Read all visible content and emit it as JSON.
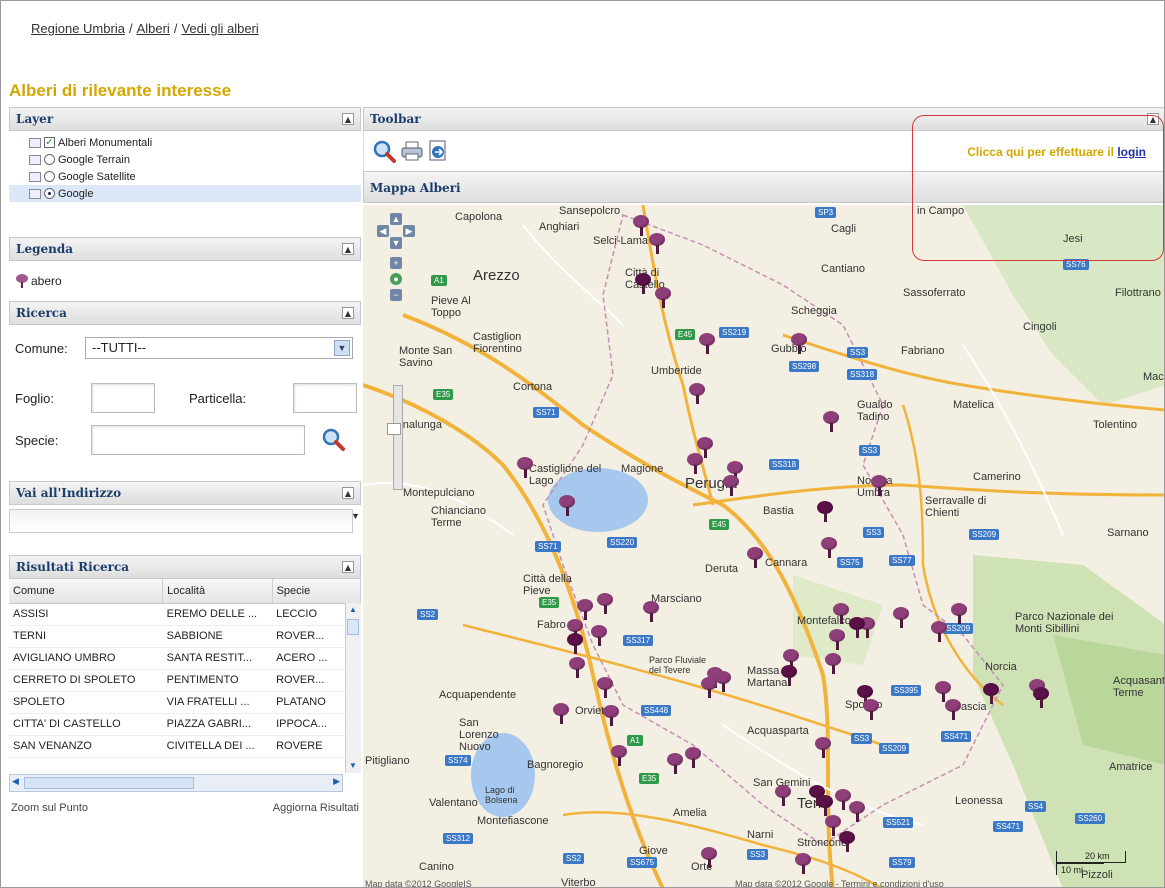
{
  "breadcrumb": {
    "items": [
      "Regione Umbria",
      "Alberi",
      "Vedi gli alberi"
    ],
    "separator": "/"
  },
  "page_title": "Alberi di rilevante interesse",
  "layer_panel": {
    "title": "Layer",
    "items": [
      {
        "label": "Alberi Monumentali",
        "control": "checkbox",
        "checked": true
      },
      {
        "label": "Google Terrain",
        "control": "radio",
        "checked": false
      },
      {
        "label": "Google Satellite",
        "control": "radio",
        "checked": false
      },
      {
        "label": "Google",
        "control": "radio",
        "checked": true
      }
    ]
  },
  "legend_panel": {
    "title": "Legenda",
    "items": [
      {
        "label": "abero",
        "icon": "tree-icon"
      }
    ]
  },
  "search_panel": {
    "title": "Ricerca",
    "comune_label": "Comune:",
    "comune_value": "--TUTTI--",
    "foglio_label": "Foglio:",
    "particella_label": "Particella:",
    "specie_label": "Specie:",
    "search_icon": "magnifier-icon"
  },
  "address_panel": {
    "title": "Vai all'Indirizzo",
    "value": ""
  },
  "results_panel": {
    "title": "Risultati Ricerca",
    "columns": [
      "Comune",
      "Località",
      "Specie"
    ],
    "rows": [
      [
        "ASSISI",
        "EREMO DELLE ...",
        "LECCIO"
      ],
      [
        "TERNI",
        "SABBIONE",
        "ROVER..."
      ],
      [
        "AVIGLIANO UMBRO",
        "SANTA RESTIT...",
        "ACERO ..."
      ],
      [
        "CERRETO DI SPOLETO",
        "PENTIMENTO",
        "ROVER..."
      ],
      [
        "SPOLETO",
        "VIA FRATELLI ...",
        "PLATANO"
      ],
      [
        "CITTA' DI CASTELLO",
        "PIAZZA GABRI...",
        "IPPOCA..."
      ],
      [
        "SAN VENANZO",
        "CIVITELLA DEI ...",
        "ROVERE"
      ]
    ],
    "zoom_label": "Zoom sul Punto",
    "refresh_label": "Aggiorna Risultati"
  },
  "toolbar": {
    "title": "Toolbar",
    "icons": [
      "zoom-icon",
      "print-icon",
      "export-icon"
    ],
    "login_prompt": "Clicca qui per effettuare il",
    "login_link": "login"
  },
  "map": {
    "title": "Mappa Alberi",
    "places": [
      "Capolona",
      "Sansepolcro",
      "Anghiari",
      "Selci-Lama",
      "Cagli",
      "Jesi",
      "Arezzo",
      "Città di Castello",
      "Cantiano",
      "Filottrano",
      "Pieve Al Toppo",
      "Sassoferrato",
      "Scheggia",
      "Cingoli",
      "Castiglion Fiorentino",
      "Monte San Savino",
      "Gubbio",
      "Fabriano",
      "Umbertide",
      "Cortona",
      "Mac",
      "Gualdo Tadino",
      "Matelica",
      "Tolentino",
      "Sinalunga",
      "Castiglione del Lago",
      "Magione",
      "Perugia",
      "Nocera Umbra",
      "Camerino",
      "Montepulciano",
      "Chianciano Terme",
      "Bastia",
      "Serravalle di Chienti",
      "Sarnano",
      "Città della Pieve",
      "Deruta",
      "Cannara",
      "Marsciano",
      "Montefalco",
      "Parco Nazionale dei Monti Sibillini",
      "Fabro",
      "Parco Fluviale del Tevere",
      "Massa Martana",
      "Norcia",
      "Acquasanta Terme",
      "Acquapendente",
      "Orvieto",
      "Spoleto",
      "Cascia",
      "San Lorenzo Nuovo",
      "Acquasparta",
      "Pitigliano",
      "Bagnoregio",
      "San Gemini",
      "Amatrice",
      "Valentano",
      "Lago di Bolsena",
      "Montefiascone",
      "Amelia",
      "Terni",
      "Leonessa",
      "Giove",
      "Narni",
      "Stroncone",
      "Canino",
      "Orte",
      "Viterbo",
      "Pizzoli",
      "in Campo"
    ],
    "scale_km": "20 km",
    "scale_mi": "10 mi",
    "attribution_left": "Map data ©2012 GoogleIS",
    "attribution_right": "Map data ©2012 Google - Termini e condizioni d'uso"
  }
}
